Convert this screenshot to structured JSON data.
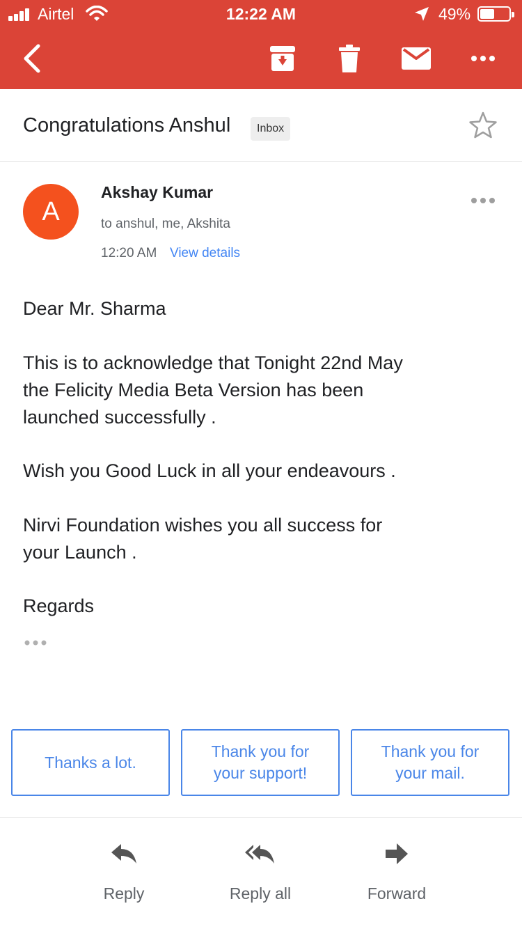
{
  "status_bar": {
    "carrier": "Airtel",
    "time": "12:22 AM",
    "battery_percent": "49%",
    "battery_level": 0.49
  },
  "app_bar": {
    "color": "#db4437",
    "icons": [
      "back-arrow-icon",
      "archive-icon",
      "trash-icon",
      "mail-icon",
      "more-horizontal-icon"
    ]
  },
  "email": {
    "subject": "Congratulations Anshul",
    "label": "Inbox",
    "sender": {
      "avatar_letter": "A",
      "avatar_color": "#f4511e",
      "name": "Akshay Kumar",
      "recipients": "to anshul, me, Akshita",
      "time": "12:20 AM",
      "view_details": "View details"
    },
    "body": {
      "greeting": "Dear Mr. Sharma",
      "paragraph1": "This is to acknowledge that Tonight 22nd May\nthe Felicity Media Beta Version has been\nlaunched successfully .",
      "paragraph2": "Wish you Good Luck in all your endeavours .",
      "paragraph3": "Nirvi Foundation wishes you all success for\nyour Launch .",
      "closing": "Regards"
    }
  },
  "smart_replies": [
    "Thanks a lot.",
    "Thank you for your support!",
    "Thank you for your mail."
  ],
  "actions": {
    "reply": "Reply",
    "reply_all": "Reply all",
    "forward": "Forward"
  },
  "colors": {
    "accent_blue": "#4a86e8",
    "link_blue": "#4285f4",
    "icon_gray": "#5f6368"
  }
}
